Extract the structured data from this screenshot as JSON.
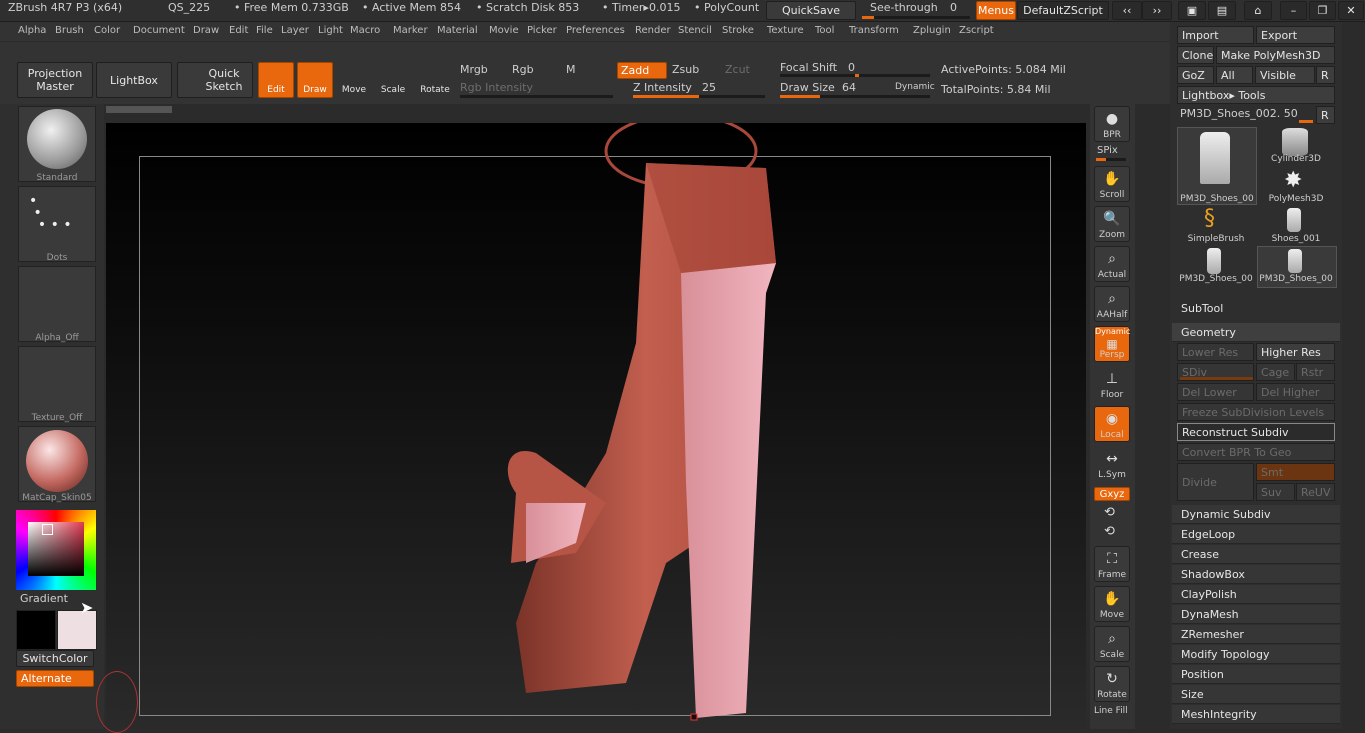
{
  "titlebar": {
    "app": "ZBrush 4R7 P3 (x64)",
    "doc": "QS_225",
    "free_mem": "• Free Mem 0.733GB",
    "active_mem": "• Active Mem 854",
    "scratch": "• Scratch Disk 853",
    "timer": "• Timer▸0.015",
    "polycount": "• PolyCount",
    "quicksave": "QuickSave",
    "seethrough": "See-through",
    "seethrough_val": "0",
    "menus": "Menus",
    "script": "DefaultZScript"
  },
  "menus": [
    "Alpha",
    "Brush",
    "Color",
    "Document",
    "Draw",
    "Edit",
    "File",
    "Layer",
    "Light",
    "Macro",
    "Marker",
    "Material",
    "Movie",
    "Picker",
    "Preferences",
    "Render",
    "Stencil",
    "Stroke",
    "Texture",
    "Tool",
    "Transform",
    "Zplugin",
    "Zscript"
  ],
  "toolbar": {
    "projection_master": "Projection Master",
    "lightbox": "LightBox",
    "quick_sketch": "Quick Sketch",
    "edit": "Edit",
    "draw": "Draw",
    "move": "Move",
    "scale": "Scale",
    "rotate": "Rotate",
    "mrgb": "Mrgb",
    "rgb": "Rgb",
    "m": "M",
    "zadd": "Zadd",
    "zsub": "Zsub",
    "zcut": "Zcut",
    "rgb_intensity": "Rgb Intensity",
    "z_intensity": "Z Intensity",
    "z_intensity_val": "25",
    "focal_shift": "Focal Shift",
    "focal_shift_val": "0",
    "draw_size": "Draw Size",
    "draw_size_val": "64",
    "dynamic": "Dynamic",
    "active_points": "ActivePoints: 5.084 Mil",
    "total_points": "TotalPoints: 5.84 Mil"
  },
  "left": {
    "brush": "Standard",
    "stroke": "Dots",
    "alpha": "Alpha_Off",
    "texture": "Texture_Off",
    "material": "MatCap_Skin05",
    "gradient": "Gradient",
    "switchcolor": "SwitchColor",
    "alternate": "Alternate"
  },
  "right": {
    "bpr": "BPR",
    "spix": "SPix",
    "scroll": "Scroll",
    "zoom": "Zoom",
    "actual": "Actual",
    "aahalf": "AAHalf",
    "persp": "Persp",
    "dynamic": "Dynamic",
    "floor": "Floor",
    "local": "Local",
    "lsym": "L.Sym",
    "xyz": "Gxyz",
    "frame": "Frame",
    "move": "Move",
    "scale": "Scale",
    "rotate": "Rotate",
    "linefill": "Line Fill"
  },
  "tool_panel": {
    "import": "Import",
    "export": "Export",
    "clone": "Clone",
    "make_polymesh": "Make PolyMesh3D",
    "goz": "GoZ",
    "all": "All",
    "visible": "Visible",
    "r": "R",
    "lightbox_tools": "Lightbox▸ Tools",
    "current_tool": "PM3D_Shoes_002. 50",
    "thumbs": [
      {
        "label": "PM3D_Shoes_00"
      },
      {
        "label": "Cylinder3D"
      },
      {
        "label": "PolyMesh3D"
      },
      {
        "label": "SimpleBrush"
      },
      {
        "label": "Shoes_001"
      },
      {
        "label": "PM3D_Shoes_00"
      },
      {
        "label": "PM3D_Shoes_00"
      }
    ],
    "subtool": "SubTool",
    "geometry": "Geometry",
    "lower_res": "Lower Res",
    "higher_res": "Higher Res",
    "sdiv": "SDiv",
    "cage": "Cage",
    "rstr": "Rstr",
    "del_lower": "Del Lower",
    "del_higher": "Del Higher",
    "freeze": "Freeze SubDivision Levels",
    "reconstruct": "Reconstruct Subdiv",
    "convert_bpr": "Convert BPR To Geo",
    "divide": "Divide",
    "smt": "Smt",
    "suv": "Suv",
    "reuv": "ReUV",
    "sections": [
      "Dynamic Subdiv",
      "EdgeLoop",
      "Crease",
      "ShadowBox",
      "ClayPolish",
      "DynaMesh",
      "ZRemesher",
      "Modify Topology",
      "Position",
      "Size",
      "MeshIntegrity"
    ]
  },
  "colors": {
    "accent": "#e9670d",
    "model": "#b85a4c",
    "model_light": "#e8a6b0"
  }
}
